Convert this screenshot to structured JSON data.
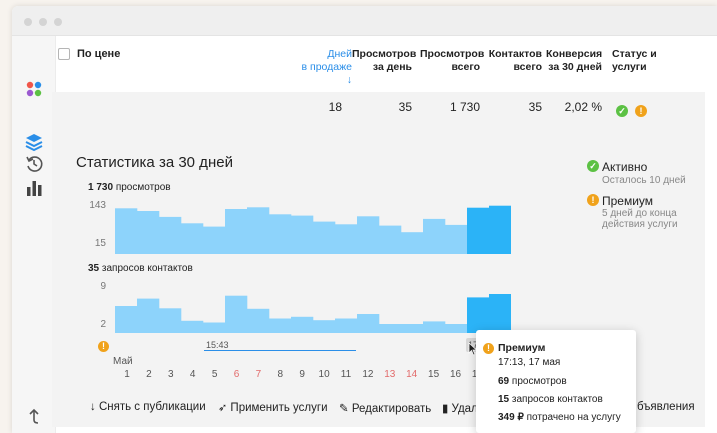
{
  "table": {
    "col_price": "По цене",
    "col_days": "Дней",
    "col_days_sub": "в продаже ↓",
    "col_views_day": "Просмотров",
    "col_views_day_sub": "за день",
    "col_views_total": "Просмотров",
    "col_views_total_sub": "всего",
    "col_contacts": "Контактов",
    "col_contacts_sub": "всего",
    "col_conv": "Конверсия",
    "col_conv_sub": "за 30 дней",
    "col_status": "Статус и услуги",
    "row": {
      "days": "18",
      "views_day": "35",
      "views_total": "1 730",
      "contacts": "35",
      "conversion": "2,02 %"
    }
  },
  "stats": {
    "title": "Статистика за 30 дней",
    "views_count": "1 730",
    "views_label": "просмотров",
    "contacts_count": "35",
    "contacts_label": "запросов контактов",
    "views_axis_top": "143",
    "views_axis_bottom": "15",
    "contacts_axis_top": "9",
    "contacts_axis_bottom": "2"
  },
  "status": {
    "active": "Активно",
    "active_sub": "Осталось 10 дней",
    "premium": "Премиум",
    "premium_sub1": "5 дней до конца",
    "premium_sub2": "действия услуги"
  },
  "timeline": {
    "start_time": "15:43",
    "end_time": "17:13",
    "month": "Май",
    "days": [
      "1",
      "2",
      "3",
      "4",
      "5",
      "6",
      "7",
      "8",
      "9",
      "10",
      "11",
      "12",
      "13",
      "14",
      "15",
      "16",
      "17"
    ]
  },
  "actions": {
    "unpublish": "Снять с публикации",
    "apply": "Применить услуги",
    "edit": "Редактировать",
    "delete": "Удалит",
    "ads": "бъявления"
  },
  "tooltip": {
    "title": "Премиум",
    "time": "17:13, 17 мая",
    "views_num": "69",
    "views_text": "просмотров",
    "contacts_num": "15",
    "contacts_text": "запросов контактов",
    "spent_num": "349 ₽",
    "spent_text": "потрачено на услугу"
  },
  "colors": {
    "bar": "#8dd3fb",
    "bar_active": "#2bb3f7",
    "accent": "#2a8ee8"
  },
  "chart_data": [
    {
      "type": "bar",
      "title": "",
      "series": [
        {
          "values": [
            130,
            122,
            104,
            85,
            75,
            128,
            133,
            112,
            108,
            90,
            82,
            106,
            78,
            58,
            98,
            80,
            132,
            138
          ]
        }
      ],
      "ylim": [
        15,
        143
      ]
    },
    {
      "type": "bar",
      "title": "",
      "series": [
        {
          "values": [
            5.5,
            6.8,
            5.1,
            2.9,
            2.6,
            7.3,
            5.0,
            3.3,
            3.6,
            3.0,
            3.3,
            4.1,
            2.2,
            1.6,
            2.8,
            1.9,
            7.0,
            7.6
          ]
        }
      ],
      "ylim": [
        2,
        9
      ]
    }
  ]
}
